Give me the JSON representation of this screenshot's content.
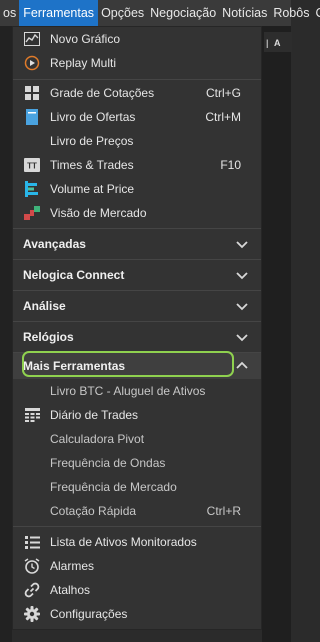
{
  "menubar": {
    "items": [
      "os",
      "Ferramentas",
      "Opções",
      "Negociação",
      "Notícias",
      "Robôs",
      "C"
    ]
  },
  "toolbar_fragment": "A",
  "menu": {
    "group1": [
      {
        "label": "Novo Gráfico",
        "shortcut": "",
        "icon": "chart-icon"
      },
      {
        "label": "Replay Multi",
        "shortcut": "",
        "icon": "replay-icon"
      }
    ],
    "group2": [
      {
        "label": "Grade de Cotações",
        "shortcut": "Ctrl+G",
        "icon": "grid-icon"
      },
      {
        "label": "Livro de Ofertas",
        "shortcut": "Ctrl+M",
        "icon": "book-icon"
      },
      {
        "label": "Livro de Preços",
        "shortcut": "",
        "icon": ""
      },
      {
        "label": "Times & Trades",
        "shortcut": "F10",
        "icon": "times-trades-icon"
      },
      {
        "label": "Volume at Price",
        "shortcut": "",
        "icon": "volume-icon"
      },
      {
        "label": "Visão de Mercado",
        "shortcut": "",
        "icon": "market-view-icon"
      }
    ],
    "sections": [
      "Avançadas",
      "Nelogica Connect",
      "Análise",
      "Relógios",
      "Mais Ferramentas"
    ],
    "more_tools": [
      {
        "label": "Livro BTC - Aluguel de Ativos",
        "shortcut": "",
        "icon": ""
      },
      {
        "label": "Diário de Trades",
        "shortcut": "",
        "icon": "calendar-icon"
      },
      {
        "label": "Calculadora Pivot",
        "shortcut": "",
        "icon": ""
      },
      {
        "label": "Frequência de Ondas",
        "shortcut": "",
        "icon": ""
      },
      {
        "label": "Frequência de Mercado",
        "shortcut": "",
        "icon": ""
      },
      {
        "label": "Cotação Rápida",
        "shortcut": "Ctrl+R",
        "icon": ""
      }
    ],
    "group_bottom": [
      {
        "label": "Lista de Ativos Monitorados",
        "icon": "list-icon"
      },
      {
        "label": "Alarmes",
        "icon": "alarm-icon"
      },
      {
        "label": "Atalhos",
        "icon": "link-icon"
      },
      {
        "label": "Configurações",
        "icon": "gear-icon"
      }
    ]
  },
  "colors": {
    "accent": "#1e73c8",
    "highlight": "#8fd14f",
    "menu_bg": "#333333"
  }
}
